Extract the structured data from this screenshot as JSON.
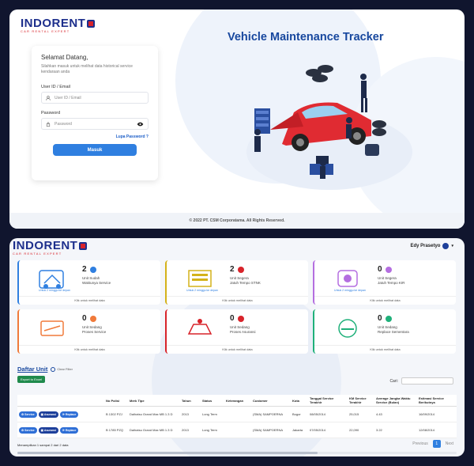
{
  "login": {
    "logo_text": "INDORENT",
    "logo_tagline": "CAR RENTAL EXPERT",
    "greeting": "Selamat Datang,",
    "subtitle": "Silahkan masuk untuk melihat data historical service kendaraan anda",
    "user_label": "User ID / Email",
    "user_placeholder": "User ID / Email",
    "password_label": "Password",
    "password_placeholder": "Password",
    "forgot": "Lupa Password ?",
    "submit": "Masuk",
    "title": "Vehicle Maintenance Tracker",
    "footer_prefix": "© 2022",
    "footer": "PT. CSM Corporatama. All Rights Reserved."
  },
  "dashboard": {
    "user_name": "Edy Prasetyo",
    "cards": [
      {
        "count": "2",
        "line1": "Unit Sudah",
        "line2": "Waktunya Service",
        "caption": "Untuk 2 minggu ke depan",
        "more": "Klik untuk melihat data",
        "color": "#2f7fe0"
      },
      {
        "count": "2",
        "line1": "Unit Segera",
        "line2": "Jatuh Tempo STNK",
        "caption": "Untuk 2 minggu ke depan",
        "more": "Klik untuk melihat data",
        "color": "#d4b21a"
      },
      {
        "count": "0",
        "line1": "Unit Segera",
        "line2": "Jatuh Tempo KIR",
        "caption": "Untuk 2 minggu ke depan",
        "more": "Klik untuk melihat data",
        "color": "#b46ee0"
      },
      {
        "count": "0",
        "line1": "Unit Sedang",
        "line2": "Proses Service",
        "caption": "",
        "more": "Klik untuk melihat data",
        "color": "#f07a3a"
      },
      {
        "count": "0",
        "line1": "Unit Sedang",
        "line2": "Proses Asuransi",
        "caption": "",
        "more": "Klik untuk melihat data",
        "color": "#d8232a"
      },
      {
        "count": "0",
        "line1": "Unit Sedang",
        "line2": "Replace Sementara",
        "caption": "",
        "more": "Klik untuk melihat data",
        "color": "#1fb07a"
      }
    ],
    "daftar_title": "Daftar Unit",
    "clear_filter": "Clear Filter",
    "export_label": "Export to Excel",
    "search_label": "Cari:",
    "columns": [
      "",
      "No Polisi",
      "Merk Tipe",
      "Tahun",
      "Status",
      "Keterangan",
      "Customer",
      "Kota",
      "Tanggal Service Terakhir",
      "KM Service Terakhir",
      "Average Jangka Waktu Service (Bulan)",
      "Estimasi Service Berikutnya"
    ],
    "action_labels": [
      "Service",
      "Asuransi",
      "Replace"
    ],
    "rows": [
      [
        "B 1302 PZJ",
        "Daihatsu Grand Max MB 1.3 D",
        "2013",
        "Long Term",
        "",
        "(SMA) SAMPOERNA",
        "Bogor",
        "08/05/2014",
        "25,015",
        "4.43",
        "16/09/2014"
      ],
      [
        "B 1785 PZQ",
        "Daihatsu Grand Max MB 1.3 D",
        "2013",
        "Long Term",
        "",
        "(SMA) SAMPOERNA",
        "Jakarta",
        "07/05/2014",
        "22,090",
        "3.22",
        "12/08/2014"
      ]
    ],
    "info": "Menampilkan 1 sampai 2 dari 2 data",
    "prev": "Previous",
    "page": "1",
    "next": "Next"
  }
}
